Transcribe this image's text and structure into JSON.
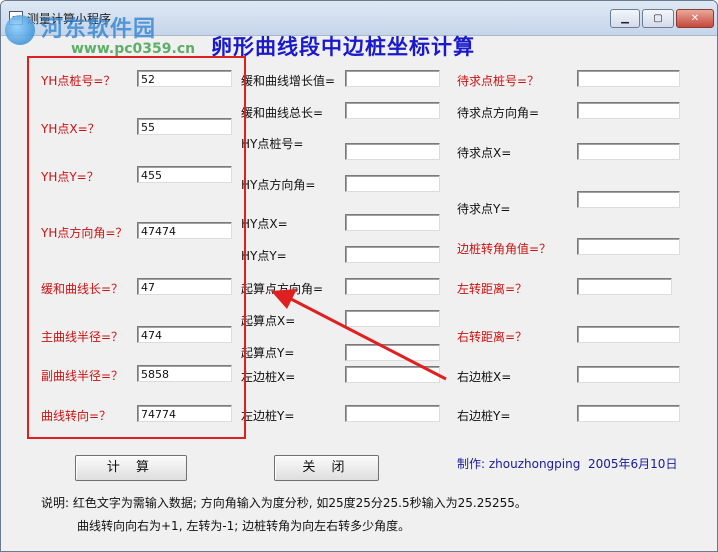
{
  "window": {
    "title": "测量计算小程序",
    "controls": [
      "minimize",
      "maximize",
      "close"
    ]
  },
  "watermark": {
    "name": "河东软件园",
    "url": "www.pc0359.cn"
  },
  "main_title": "卵形曲线段中边桩坐标计算",
  "inputs_left": [
    {
      "label": "YH点桩号=？",
      "value": "52"
    },
    {
      "label": "YH点X=？",
      "value": "55"
    },
    {
      "label": "YH点Y=？",
      "value": "455"
    },
    {
      "label": "YH点方向角=？",
      "value": "47474"
    },
    {
      "label": "缓和曲线长=？",
      "value": "47"
    },
    {
      "label": "主曲线半径=？",
      "value": "474"
    },
    {
      "label": "副曲线半径=？",
      "value": "5858"
    },
    {
      "label": "曲线转向=？",
      "value": "74774"
    }
  ],
  "middle": [
    {
      "label": "缓和曲线增长值=",
      "value": ""
    },
    {
      "label": "缓和曲线总长=",
      "value": ""
    },
    {
      "label": "HY点桩号=",
      "value": ""
    },
    {
      "label": "HY点方向角=",
      "value": ""
    },
    {
      "label": "HY点X=",
      "value": ""
    },
    {
      "label": "HY点Y=",
      "value": ""
    },
    {
      "label": "起算点方向角=",
      "value": ""
    },
    {
      "label": "起算点X=",
      "value": ""
    },
    {
      "label": "起算点Y=",
      "value": ""
    },
    {
      "label": "左边桩X=",
      "value": ""
    },
    {
      "label": "左边桩Y=",
      "value": ""
    }
  ],
  "right": [
    {
      "label": "待求点桩号=？",
      "value": ""
    },
    {
      "label": "待求点方向角=",
      "value": ""
    },
    {
      "label": "待求点X=",
      "value": ""
    },
    {
      "label": "待求点Y=",
      "value": ""
    },
    {
      "label": "边桩转角角值=？",
      "value": ""
    },
    {
      "label": "左转距离=？",
      "value": ""
    },
    {
      "label": "右转距离=？",
      "value": ""
    },
    {
      "label": "右边桩X=",
      "value": ""
    },
    {
      "label": "右边桩Y=",
      "value": ""
    }
  ],
  "buttons": {
    "calculate": "计 算",
    "close": "关 闭"
  },
  "credit": {
    "author": "制作: zhouzhongping",
    "date": "2005年6月10日"
  },
  "notes": [
    "说明: 红色文字为需输入数据; 方向角输入为度分秒, 如25度25分25.5秒输入为25.25255。",
    "曲线转向向右为+1, 左转为-1; 边桩转角为向左右转多少角度。"
  ],
  "colors": {
    "input_label": "#cc1111",
    "title": "#1a1acc",
    "annotation": "#e02020"
  }
}
